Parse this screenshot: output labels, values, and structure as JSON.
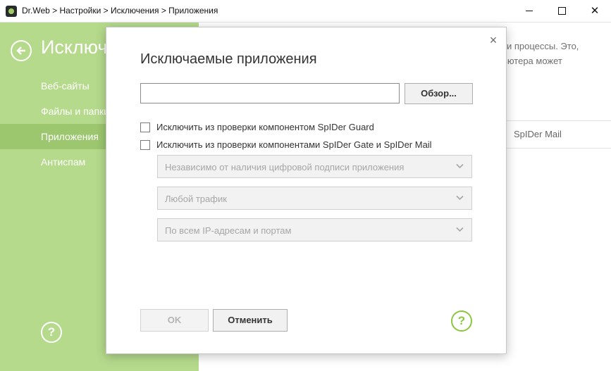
{
  "window": {
    "title": "Dr.Web > Настройки > Исключения > Приложения",
    "minimize_glyph": "",
    "maximize_glyph": "",
    "close_glyph": "✕"
  },
  "sidebar": {
    "section_title": "Исключения",
    "items": [
      {
        "label": "Веб-сайты"
      },
      {
        "label": "Файлы и папки"
      },
      {
        "label": "Приложения"
      },
      {
        "label": "Антиспам"
      }
    ],
    "help_label": "?"
  },
  "main": {
    "description_lines": [
      "ы и процессы. Это,",
      "пьютера может"
    ],
    "table_header": "SpIDer Mail"
  },
  "dialog": {
    "title": "Исключаемые приложения",
    "path_value": "",
    "browse_label": "Обзор...",
    "checkbox1_label": "Исключить из проверки компонентом SpIDer Guard",
    "checkbox2_label": "Исключить из проверки компонентами SpIDer Gate и SpIDer Mail",
    "select_signature": "Независимо от наличия цифровой подписи приложения",
    "select_traffic": "Любой трафик",
    "select_addresses": "По всем IP-адресам и портам",
    "ok_label": "OK",
    "cancel_label": "Отменить",
    "help_label": "?",
    "close_glyph": "×"
  },
  "colors": {
    "sidebar_bg": "#b5da8c",
    "sidebar_active": "#9cc76f",
    "accent_green": "#8dc63f"
  }
}
